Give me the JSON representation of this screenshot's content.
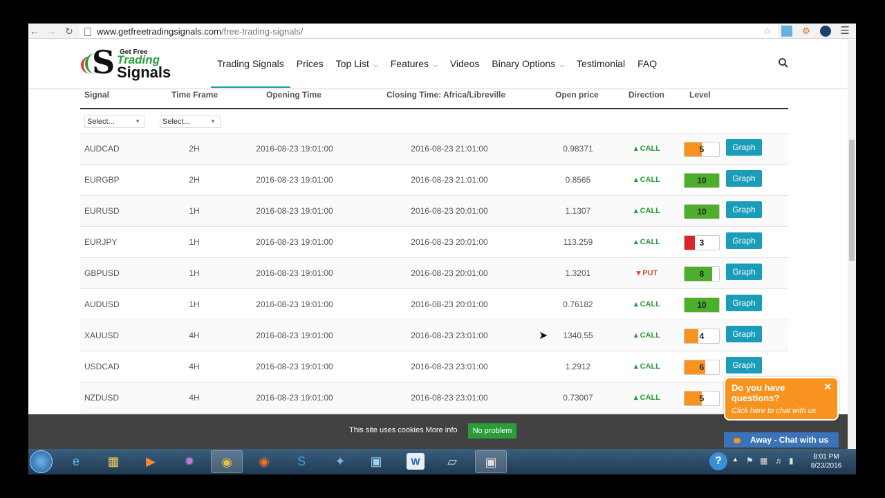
{
  "browser": {
    "url_domain": "www.getfreetradingsignals.com",
    "url_path": "/free-trading-signals/"
  },
  "site": {
    "logo_top": "Get Free",
    "logo_trading": "Trading",
    "logo_signals": "Signals",
    "nav": [
      {
        "label": "Trading Signals",
        "dropdown": false
      },
      {
        "label": "Prices",
        "dropdown": false
      },
      {
        "label": "Top List",
        "dropdown": true
      },
      {
        "label": "Features",
        "dropdown": true
      },
      {
        "label": "Videos",
        "dropdown": false
      },
      {
        "label": "Binary Options",
        "dropdown": true
      },
      {
        "label": "Testimonial",
        "dropdown": false
      },
      {
        "label": "FAQ",
        "dropdown": false
      }
    ]
  },
  "table": {
    "headers": {
      "signal": "Signal",
      "time_frame": "Time Frame",
      "opening_time": "Opening Time",
      "closing_time": "Closing Time: Africa/Libreville",
      "open_price": "Open price",
      "direction": "Direction",
      "level": "Level"
    },
    "filters": {
      "signal_select": "Select...",
      "timeframe_select": "Select..."
    },
    "graph_label": "Graph",
    "rows": [
      {
        "signal": "AUDCAD",
        "tf": "2H",
        "open": "2016-08-23 19:01:00",
        "close": "2016-08-23 21:01:00",
        "price": "0.98371",
        "dir": "CALL",
        "level": "5"
      },
      {
        "signal": "EURGBP",
        "tf": "2H",
        "open": "2016-08-23 19:01:00",
        "close": "2016-08-23 21:01:00",
        "price": "0.8565",
        "dir": "CALL",
        "level": "10"
      },
      {
        "signal": "EURUSD",
        "tf": "1H",
        "open": "2016-08-23 19:01:00",
        "close": "2016-08-23 20:01:00",
        "price": "1.1307",
        "dir": "CALL",
        "level": "10"
      },
      {
        "signal": "EURJPY",
        "tf": "1H",
        "open": "2016-08-23 19:01:00",
        "close": "2016-08-23 20:01:00",
        "price": "113.259",
        "dir": "CALL",
        "level": "3"
      },
      {
        "signal": "GBPUSD",
        "tf": "1H",
        "open": "2016-08-23 19:01:00",
        "close": "2016-08-23 20:01:00",
        "price": "1.3201",
        "dir": "PUT",
        "level": "8"
      },
      {
        "signal": "AUDUSD",
        "tf": "1H",
        "open": "2016-08-23 19:01:00",
        "close": "2016-08-23 20:01:00",
        "price": "0.76182",
        "dir": "CALL",
        "level": "10"
      },
      {
        "signal": "XAUUSD",
        "tf": "4H",
        "open": "2016-08-23 19:01:00",
        "close": "2016-08-23 23:01:00",
        "price": "1340.55",
        "dir": "CALL",
        "level": "4"
      },
      {
        "signal": "USDCAD",
        "tf": "4H",
        "open": "2016-08-23 19:01:00",
        "close": "2016-08-23 23:01:00",
        "price": "1.2912",
        "dir": "CALL",
        "level": "6"
      },
      {
        "signal": "NZDUSD",
        "tf": "4H",
        "open": "2016-08-23 19:01:00",
        "close": "2016-08-23 23:01:00",
        "price": "0.73007",
        "dir": "CALL",
        "level": "5"
      }
    ]
  },
  "cookie": {
    "text": "This site uses cookies More info",
    "button": "No problem"
  },
  "chat": {
    "question": "Do you have questions?",
    "sub": "Click here to chat with us",
    "bar": "Away - Chat with us"
  },
  "taskbar": {
    "time": "8:01 PM",
    "date": "8/23/2016"
  },
  "colors": {
    "accent": "#1a9db8",
    "call": "#2a9d3a",
    "put": "#e2452a",
    "level_high": "#4caf2a",
    "level_mid": "#f7931e",
    "level_low": "#d9262a"
  }
}
